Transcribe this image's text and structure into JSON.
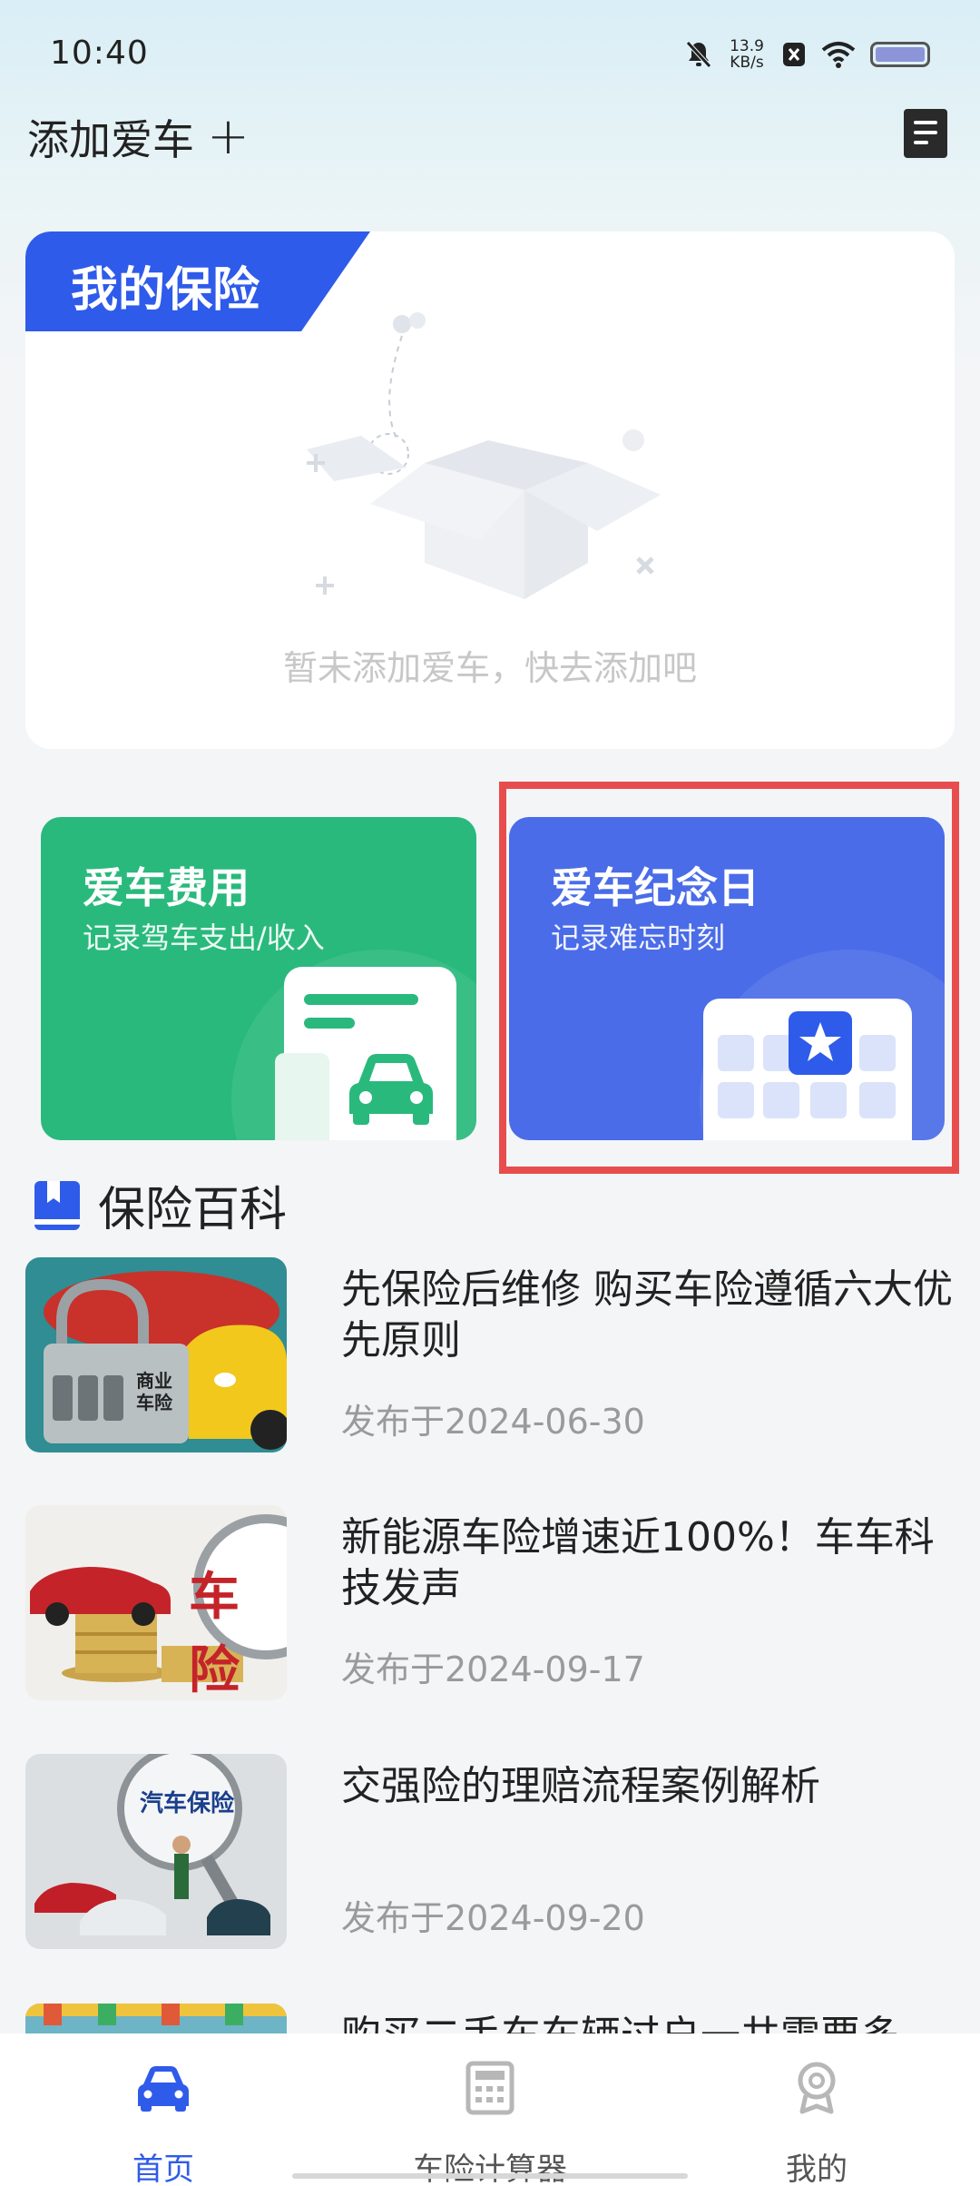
{
  "status": {
    "time": "10:40",
    "speed_value": "13.9",
    "speed_unit": "KB/s"
  },
  "header": {
    "add_car_label": "添加爱车",
    "add_car_plus": "+"
  },
  "insurance_card": {
    "title": "我的保险",
    "empty_text": "暂未添加爱车，快去添加吧"
  },
  "features": {
    "cost": {
      "title": "爱车费用",
      "subtitle": "记录驾车支出/收入",
      "color": "#29b97c"
    },
    "anniversary": {
      "title": "爱车纪念日",
      "subtitle": "记录难忘时刻",
      "color": "#4a6ce8"
    }
  },
  "section": {
    "title": "保险百科"
  },
  "articles": [
    {
      "title": "先保险后维修 购买车险遵循六大优先原则",
      "date": "发布于2024-06-30",
      "thumb_text": "商业\n车险"
    },
    {
      "title": "新能源车险增速近100%！车车科技发声",
      "date": "发布于2024-09-17",
      "thumb_text": "车险"
    },
    {
      "title": "交强险的理赔流程案例解析",
      "date": "发布于2024-09-20",
      "thumb_text": "汽车保险"
    },
    {
      "title": "购买二手车车辆过户一共需要多",
      "date": "",
      "thumb_text": ""
    }
  ],
  "tabbar": [
    {
      "label": "首页",
      "icon": "car-icon",
      "active": true
    },
    {
      "label": "车险计算器",
      "icon": "calculator-icon",
      "active": false
    },
    {
      "label": "我的",
      "icon": "profile-icon",
      "active": false
    }
  ],
  "colors": {
    "accent": "#2f5bea",
    "highlight": "#e84d4d",
    "green": "#29b97c"
  }
}
